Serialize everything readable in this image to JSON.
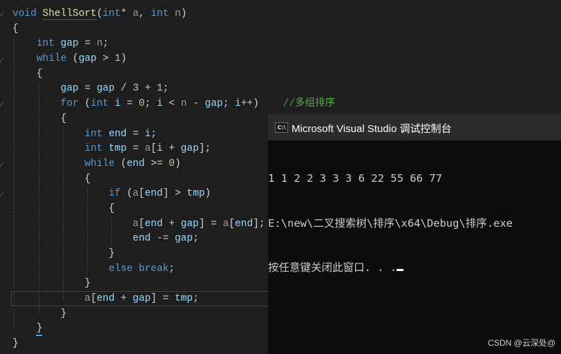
{
  "editor": {
    "lines": [
      [
        [
          "kw",
          "void "
        ],
        [
          "fn",
          "ShellSort"
        ],
        [
          "op",
          "("
        ],
        [
          "ty",
          "int"
        ],
        [
          "op",
          "* "
        ],
        [
          "pa",
          "a"
        ],
        [
          "op",
          ", "
        ],
        [
          "ty",
          "int "
        ],
        [
          "pa",
          "n"
        ],
        [
          "op",
          ")"
        ]
      ],
      [
        [
          "op",
          "{"
        ]
      ],
      [
        [
          "op",
          "    "
        ],
        [
          "ty",
          "int "
        ],
        [
          "va",
          "gap"
        ],
        [
          "op",
          " = "
        ],
        [
          "pa",
          "n"
        ],
        [
          "op",
          ";"
        ]
      ],
      [
        [
          "op",
          "    "
        ],
        [
          "kw",
          "while"
        ],
        [
          "op",
          " ("
        ],
        [
          "va",
          "gap"
        ],
        [
          "op",
          " > "
        ],
        [
          "nu",
          "1"
        ],
        [
          "op",
          ")"
        ]
      ],
      [
        [
          "op",
          "    {"
        ]
      ],
      [
        [
          "op",
          "        "
        ],
        [
          "va",
          "gap"
        ],
        [
          "op",
          " = "
        ],
        [
          "va",
          "gap"
        ],
        [
          "op",
          " / "
        ],
        [
          "nu",
          "3"
        ],
        [
          "op",
          " + "
        ],
        [
          "nu",
          "1"
        ],
        [
          "op",
          ";"
        ]
      ],
      [
        [
          "op",
          "        "
        ],
        [
          "kw",
          "for"
        ],
        [
          "op",
          " ("
        ],
        [
          "ty",
          "int "
        ],
        [
          "va",
          "i"
        ],
        [
          "op",
          " = "
        ],
        [
          "nu",
          "0"
        ],
        [
          "op",
          "; "
        ],
        [
          "va",
          "i"
        ],
        [
          "op",
          " < "
        ],
        [
          "pa",
          "n"
        ],
        [
          "op",
          " - "
        ],
        [
          "va",
          "gap"
        ],
        [
          "op",
          "; "
        ],
        [
          "va",
          "i"
        ],
        [
          "op",
          "++)    "
        ],
        [
          "cm",
          "//多组排序"
        ]
      ],
      [
        [
          "op",
          "        {"
        ]
      ],
      [
        [
          "op",
          "            "
        ],
        [
          "ty",
          "int "
        ],
        [
          "va",
          "end"
        ],
        [
          "op",
          " = "
        ],
        [
          "va",
          "i"
        ],
        [
          "op",
          ";"
        ]
      ],
      [
        [
          "op",
          "            "
        ],
        [
          "ty",
          "int "
        ],
        [
          "va",
          "tmp"
        ],
        [
          "op",
          " = "
        ],
        [
          "pa",
          "a"
        ],
        [
          "op",
          "["
        ],
        [
          "va",
          "i"
        ],
        [
          "op",
          " + "
        ],
        [
          "va",
          "gap"
        ],
        [
          "op",
          "];"
        ]
      ],
      [
        [
          "op",
          "            "
        ],
        [
          "kw",
          "while"
        ],
        [
          "op",
          " ("
        ],
        [
          "va",
          "end"
        ],
        [
          "op",
          " >= "
        ],
        [
          "nu",
          "0"
        ],
        [
          "op",
          ")"
        ]
      ],
      [
        [
          "op",
          "            {"
        ]
      ],
      [
        [
          "op",
          "                "
        ],
        [
          "kw",
          "if"
        ],
        [
          "op",
          " ("
        ],
        [
          "pa",
          "a"
        ],
        [
          "op",
          "["
        ],
        [
          "va",
          "end"
        ],
        [
          "op",
          "] > "
        ],
        [
          "va",
          "tmp"
        ],
        [
          "op",
          ")"
        ]
      ],
      [
        [
          "op",
          "                {"
        ]
      ],
      [
        [
          "op",
          "                    "
        ],
        [
          "pa",
          "a"
        ],
        [
          "op",
          "["
        ],
        [
          "va",
          "end"
        ],
        [
          "op",
          " + "
        ],
        [
          "va",
          "gap"
        ],
        [
          "op",
          "] = "
        ],
        [
          "pa",
          "a"
        ],
        [
          "op",
          "["
        ],
        [
          "va",
          "end"
        ],
        [
          "op",
          "];"
        ]
      ],
      [
        [
          "op",
          "                    "
        ],
        [
          "va",
          "end"
        ],
        [
          "op",
          " -= "
        ],
        [
          "va",
          "gap"
        ],
        [
          "op",
          ";"
        ]
      ],
      [
        [
          "op",
          "                }"
        ]
      ],
      [
        [
          "op",
          "                "
        ],
        [
          "kw",
          "else break"
        ],
        [
          "op",
          ";"
        ]
      ],
      [
        [
          "op",
          "            }"
        ]
      ],
      [
        [
          "op",
          "            "
        ],
        [
          "pa",
          "a"
        ],
        [
          "op",
          "["
        ],
        [
          "va",
          "end"
        ],
        [
          "op",
          " + "
        ],
        [
          "va",
          "gap"
        ],
        [
          "op",
          "] = "
        ],
        [
          "va",
          "tmp"
        ],
        [
          "op",
          ";"
        ]
      ],
      [
        [
          "op",
          "        }"
        ]
      ],
      [
        [
          "op",
          "    }"
        ]
      ],
      [
        [
          "op",
          "}"
        ]
      ]
    ]
  },
  "console": {
    "title": "Microsoft Visual Studio 调试控制台",
    "icon": "C:\\",
    "output": [
      "1 1 2 2 3 3 3 6 22 55 66 77",
      "E:\\new\\二叉搜索树\\排序\\x64\\Debug\\排序.exe",
      "按任意键关闭此窗口. . ."
    ]
  },
  "watermark": "CSDN @云深处@"
}
